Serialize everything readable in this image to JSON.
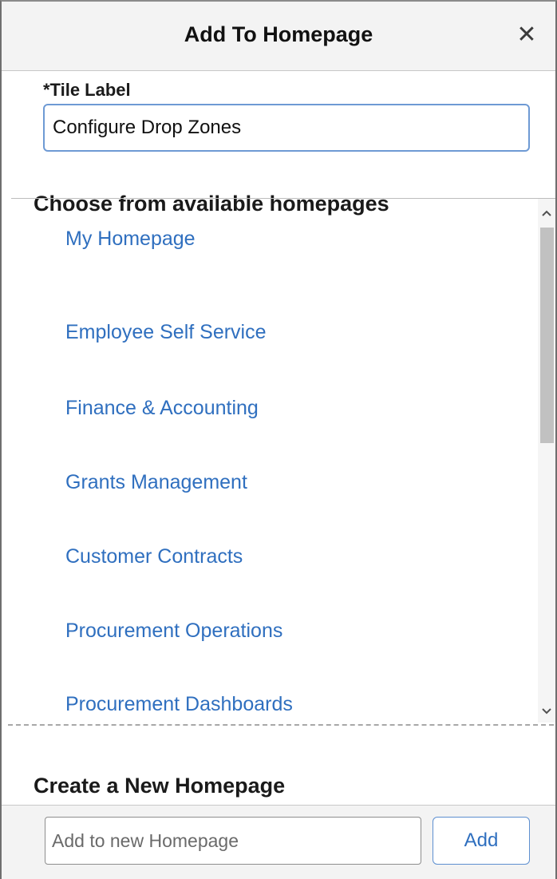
{
  "dialog": {
    "title": "Add To Homepage",
    "close_icon": "close-icon",
    "close_glyph": "✕"
  },
  "tile_label": {
    "label": "*Tile Label",
    "value": "Configure Drop Zones"
  },
  "homepages": {
    "heading": "Choose from available homepages",
    "items": [
      {
        "label": "My Homepage"
      },
      {
        "label": "Employee Self Service"
      },
      {
        "label": "Finance & Accounting"
      },
      {
        "label": "Grants Management"
      },
      {
        "label": "Customer Contracts"
      },
      {
        "label": "Procurement Operations"
      },
      {
        "label": "Procurement Dashboards"
      }
    ],
    "scroll_up_icon": "chevron-up-icon",
    "scroll_down_icon": "chevron-down-icon"
  },
  "new_homepage": {
    "heading": "Create a New Homepage",
    "placeholder": "Add to new Homepage",
    "add_label": "Add"
  },
  "colors": {
    "link": "#2f6fbf",
    "header_bg": "#f3f3f3",
    "input_focus_border": "#6e9ad4"
  }
}
